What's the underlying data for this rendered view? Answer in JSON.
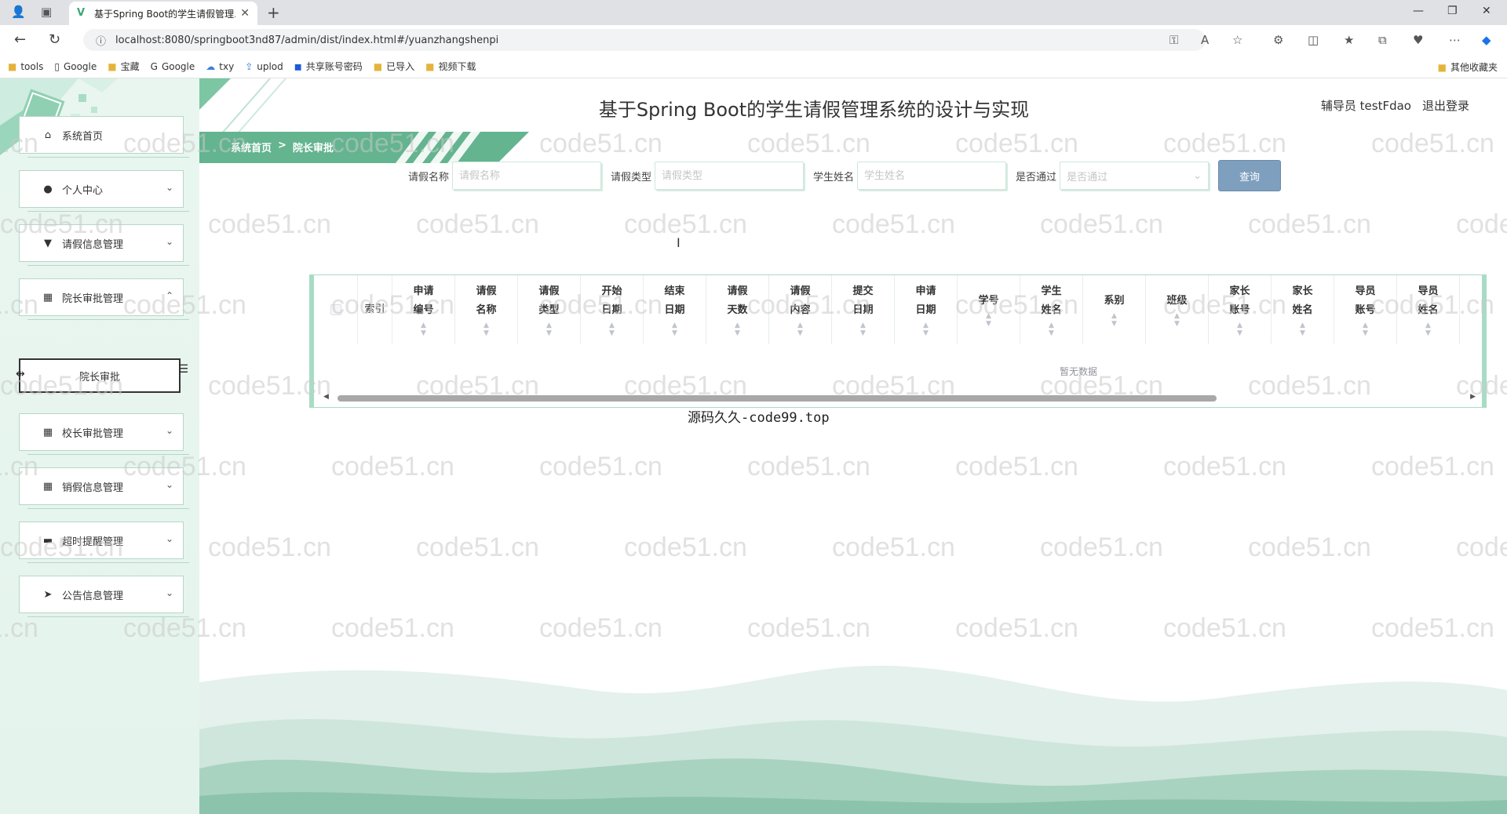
{
  "browser": {
    "tab_title": "基于Spring Boot的学生请假管理...",
    "url": "localhost:8080/springboot3nd87/admin/dist/index.html#/yuanzhangshenpi",
    "bookmarks": [
      "tools",
      "Google",
      "宝藏",
      "Google",
      "txy",
      "uplod",
      "共享账号密码",
      "已导入",
      "视频下载"
    ],
    "other_bookmarks": "其他收藏夹"
  },
  "app": {
    "title": "基于Spring Boot的学生请假管理系统的设计与实现",
    "user_label": "辅导员 testFdao",
    "logout": "退出登录"
  },
  "breadcrumb": {
    "home": "系统首页",
    "separator": ">",
    "current": "院长审批"
  },
  "sidebar": {
    "items": [
      {
        "label": "系统首页",
        "icon": "home-icon",
        "arrow": ""
      },
      {
        "label": "个人中心",
        "icon": "user-icon",
        "arrow": "⌄"
      },
      {
        "label": "请假信息管理",
        "icon": "pin-icon",
        "arrow": "⌄"
      },
      {
        "label": "院长审批管理",
        "icon": "grid-icon",
        "arrow": "⌃"
      },
      {
        "label": "校长审批管理",
        "icon": "grid-icon",
        "arrow": "⌄"
      },
      {
        "label": "销假信息管理",
        "icon": "grid-icon",
        "arrow": "⌄"
      },
      {
        "label": "超时提醒管理",
        "icon": "briefcase-icon",
        "arrow": "⌄"
      },
      {
        "label": "公告信息管理",
        "icon": "send-icon",
        "arrow": "⌄"
      }
    ],
    "submenu_active": "院长审批"
  },
  "search": {
    "name_label": "请假名称",
    "name_placeholder": "请假名称",
    "type_label": "请假类型",
    "type_placeholder": "请假类型",
    "student_label": "学生姓名",
    "student_placeholder": "学生姓名",
    "passed_label": "是否通过",
    "passed_placeholder": "是否通过",
    "query_button": "查询"
  },
  "table": {
    "index_header": "索引",
    "columns": [
      "申请编号",
      "请假名称",
      "请假类型",
      "开始日期",
      "结束日期",
      "请假天数",
      "请假内容",
      "提交日期",
      "申请日期",
      "学号",
      "学生姓名",
      "系别",
      "班级",
      "家长账号",
      "家长姓名",
      "导员账号",
      "导员姓名"
    ],
    "empty_text": "暂无数据"
  },
  "source_note": "源码久久-code99.top",
  "watermark": "code51.cn",
  "colors": {
    "accent": "#6fbf9a",
    "sidebar_bg": "#e6f5ee",
    "query_button": "#7e9fbd"
  }
}
